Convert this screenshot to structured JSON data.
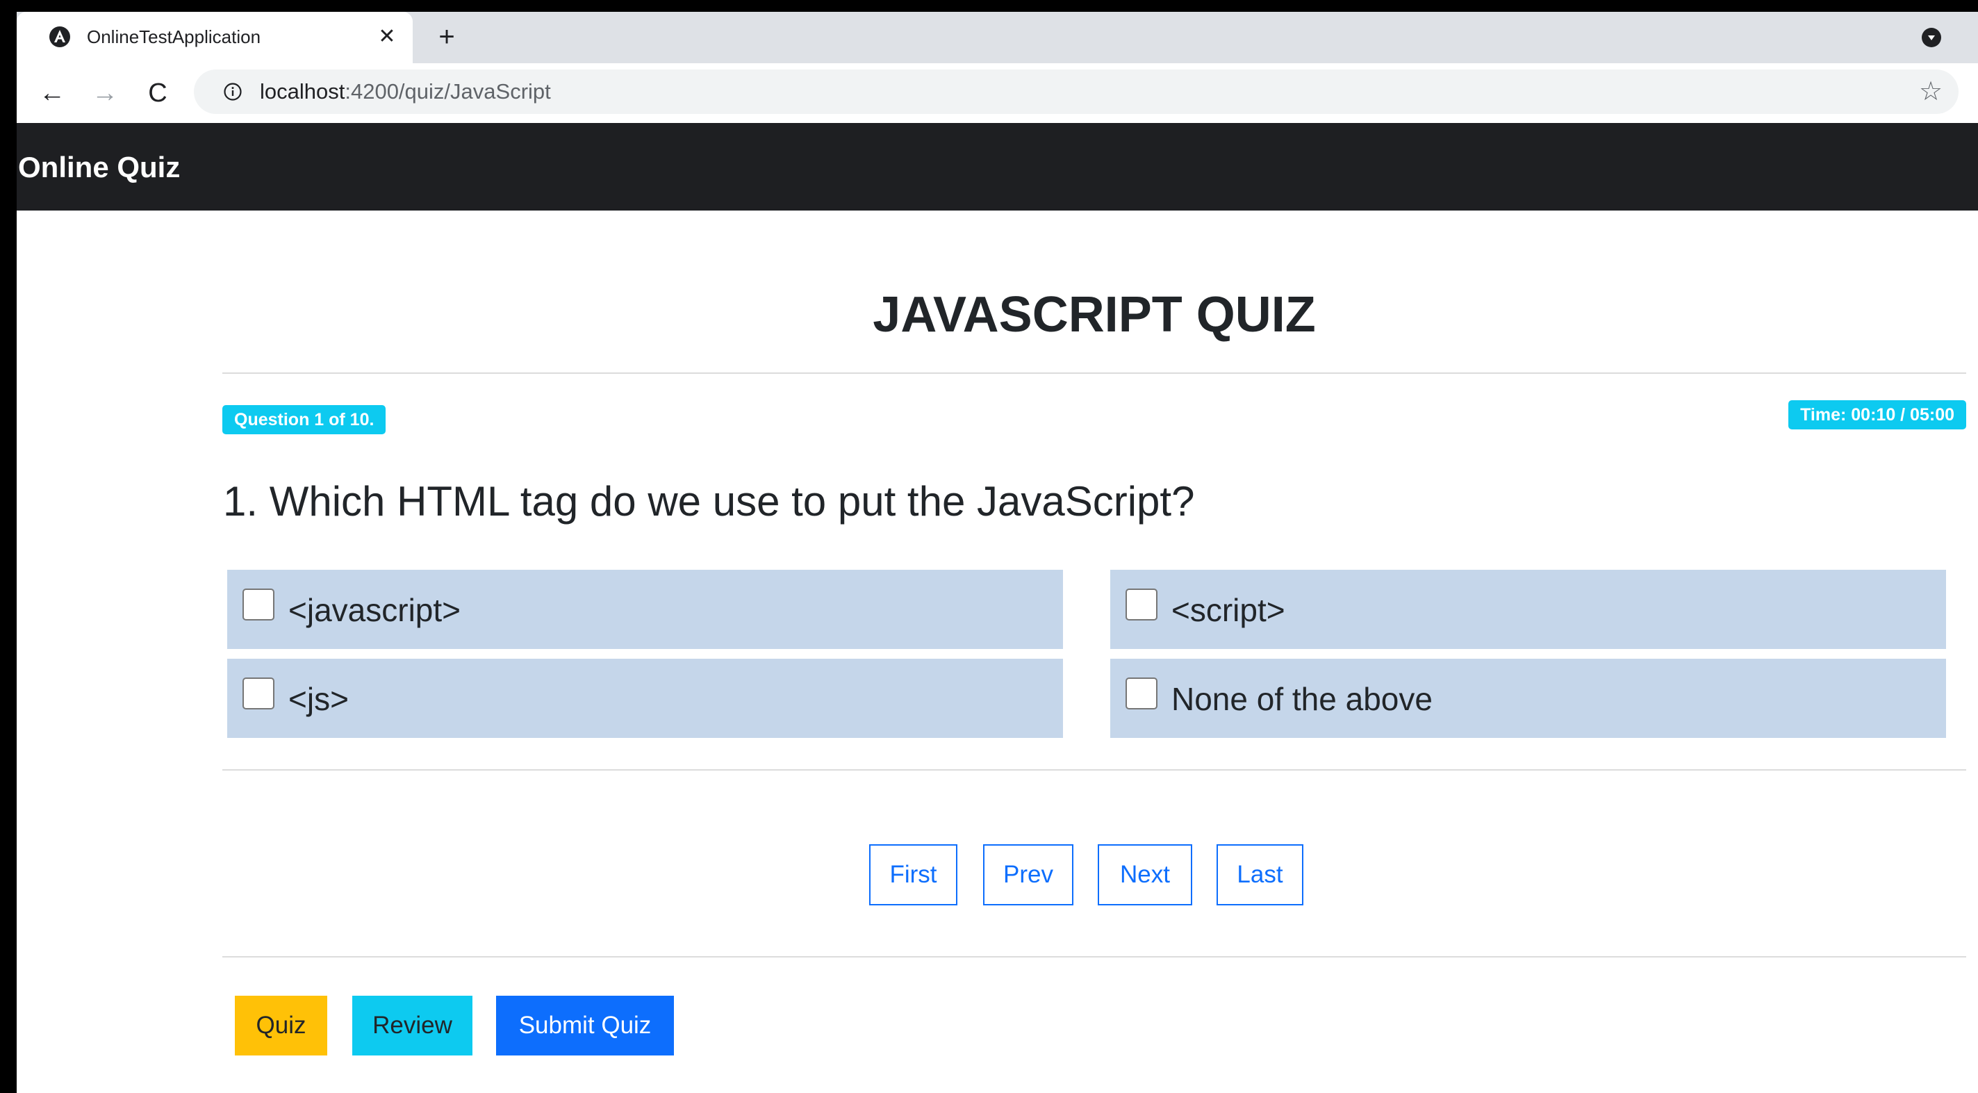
{
  "browser": {
    "tab_title": "OnlineTestApplication",
    "tab_close_glyph": "✕",
    "new_tab_glyph": "+",
    "nav_back_glyph": "←",
    "nav_forward_glyph": "→",
    "nav_reload_glyph": "C",
    "url_host": "localhost",
    "url_path": ":4200/quiz/JavaScript",
    "bookmark_glyph": "☆",
    "icons": {
      "favicon": "angular-icon",
      "site_info": "info-icon",
      "profile": "profile-icon"
    }
  },
  "navbar": {
    "brand": "Online Quiz"
  },
  "quiz": {
    "title": "JAVASCRIPT QUIZ",
    "progress_badge": "Question 1 of 10.",
    "time_badge": "Time: 00:10 / 05:00",
    "question": "1. Which HTML tag do we use to put the JavaScript?",
    "options": [
      {
        "label": "<javascript>",
        "checked": false
      },
      {
        "label": "<script>",
        "checked": false
      },
      {
        "label": "<js>",
        "checked": false
      },
      {
        "label": "None of the above",
        "checked": false
      }
    ]
  },
  "pager": {
    "first": "First",
    "prev": "Prev",
    "next": "Next",
    "last": "Last"
  },
  "actions": {
    "quiz": "Quiz",
    "review": "Review",
    "submit": "Submit Quiz"
  },
  "colors": {
    "navbar_bg": "#1e1f22",
    "badge_bg": "#0dcaf0",
    "option_bg": "#c5d6ea",
    "primary": "#0d6efd",
    "warning": "#ffc107",
    "info": "#0dcaf0"
  }
}
